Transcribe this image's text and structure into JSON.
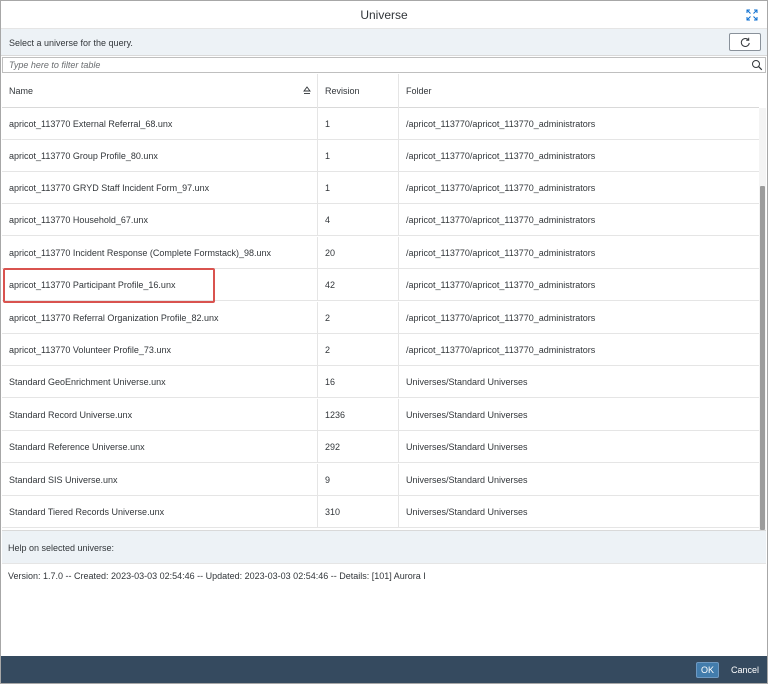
{
  "dialog": {
    "title": "Universe",
    "expand_icon": "expand-icon"
  },
  "subheader": {
    "hint": "Select a universe for the query.",
    "refresh_icon": "refresh-icon"
  },
  "filter": {
    "placeholder": "Type here to filter table",
    "value": "",
    "search_icon": "search-icon"
  },
  "table": {
    "columns": {
      "name": "Name",
      "revision": "Revision",
      "folder": "Folder"
    },
    "sort_icon": "sort-ascending-icon",
    "rows": [
      {
        "name": "apricot_113770 External Referral_68.unx",
        "revision": "1",
        "folder": "/apricot_113770/apricot_113770_administrators"
      },
      {
        "name": "apricot_113770 Group Profile_80.unx",
        "revision": "1",
        "folder": "/apricot_113770/apricot_113770_administrators"
      },
      {
        "name": "apricot_113770 GRYD Staff Incident Form_97.unx",
        "revision": "1",
        "folder": "/apricot_113770/apricot_113770_administrators"
      },
      {
        "name": "apricot_113770 Household_67.unx",
        "revision": "4",
        "folder": "/apricot_113770/apricot_113770_administrators"
      },
      {
        "name": "apricot_113770 Incident Response (Complete Formstack)_98.unx",
        "revision": "20",
        "folder": "/apricot_113770/apricot_113770_administrators"
      },
      {
        "name": "apricot_113770 Participant Profile_16.unx",
        "revision": "42",
        "folder": "/apricot_113770/apricot_113770_administrators"
      },
      {
        "name": "apricot_113770 Referral Organization Profile_82.unx",
        "revision": "2",
        "folder": "/apricot_113770/apricot_113770_administrators"
      },
      {
        "name": "apricot_113770 Volunteer Profile_73.unx",
        "revision": "2",
        "folder": "/apricot_113770/apricot_113770_administrators"
      },
      {
        "name": "Standard GeoEnrichment Universe.unx",
        "revision": "16",
        "folder": "Universes/Standard Universes"
      },
      {
        "name": "Standard Record Universe.unx",
        "revision": "1236",
        "folder": "Universes/Standard Universes"
      },
      {
        "name": "Standard Reference Universe.unx",
        "revision": "292",
        "folder": "Universes/Standard Universes"
      },
      {
        "name": "Standard SIS Universe.unx",
        "revision": "9",
        "folder": "Universes/Standard Universes"
      },
      {
        "name": "Standard Tiered Records Universe.unx",
        "revision": "310",
        "folder": "Universes/Standard Universes"
      }
    ]
  },
  "help": {
    "label": "Help on selected universe:",
    "details": "Version: 1.7.0 -- Created: 2023-03-03 02:54:46 -- Updated: 2023-03-03 02:54:46 -- Details: [101] Aurora I"
  },
  "footer": {
    "ok_label": "OK",
    "cancel_label": "Cancel"
  },
  "colors": {
    "footer_bg": "#354a5f",
    "ok_button": "#427cac",
    "highlight_border": "#d9534f",
    "subheader_bg": "#edf2f6"
  }
}
